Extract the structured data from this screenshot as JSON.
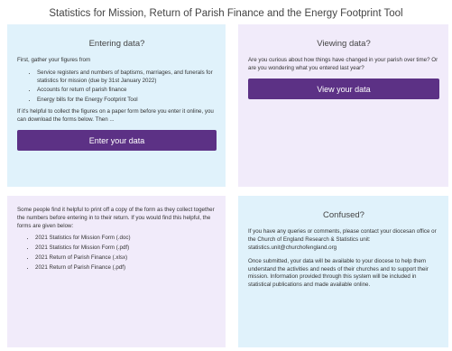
{
  "page": {
    "title": "Statistics for Mission, Return of Parish Finance and the Energy Footprint Tool"
  },
  "entering": {
    "heading": "Entering data?",
    "intro": "First, gather your figures from",
    "items": [
      "Service registers and numbers of baptisms, marriages, and funerals for statistics for mission (due by 31st January 2022)",
      "Accounts for return of parish finance",
      "Energy bills for the Energy Footprint Tool"
    ],
    "paper_note": "If it's helpful to collect the figures on a paper form before you enter it online, you can download the forms below. Then ...",
    "button_label": "Enter your data"
  },
  "viewing": {
    "heading": "Viewing data?",
    "text": "Are you curious about how things have changed in your parish over time? Or are you wondering what you entered last year?",
    "button_label": "View your data"
  },
  "forms": {
    "intro": "Some people find it helpful to print off a copy of the form as they collect together the numbers before entering in to their return. If you would find this helpful, the forms are given below:",
    "links": [
      "2021 Statistics for Mission Form (.doc)",
      "2021 Statistics for Mission Form (.pdf)",
      "2021 Return of Parish Finance (.xlsx)",
      "2021 Return of Parish Finance (.pdf)"
    ]
  },
  "confused": {
    "heading": "Confused?",
    "contact_text": "If you have any queries or comments, please contact your diocesan office or the Church of England Research & Statistics unit: statistics.unit@churchofengland.org",
    "submitted_text": "Once submitted, your data will be available to your diocese to help them understand the activities and needs of their churches and to support their mission. Information provided through this system will be included in statistical publications and made available online."
  },
  "colors": {
    "accent": "#5c3185",
    "card_blue": "#e0f2fb",
    "card_purple": "#f1ebfa"
  }
}
